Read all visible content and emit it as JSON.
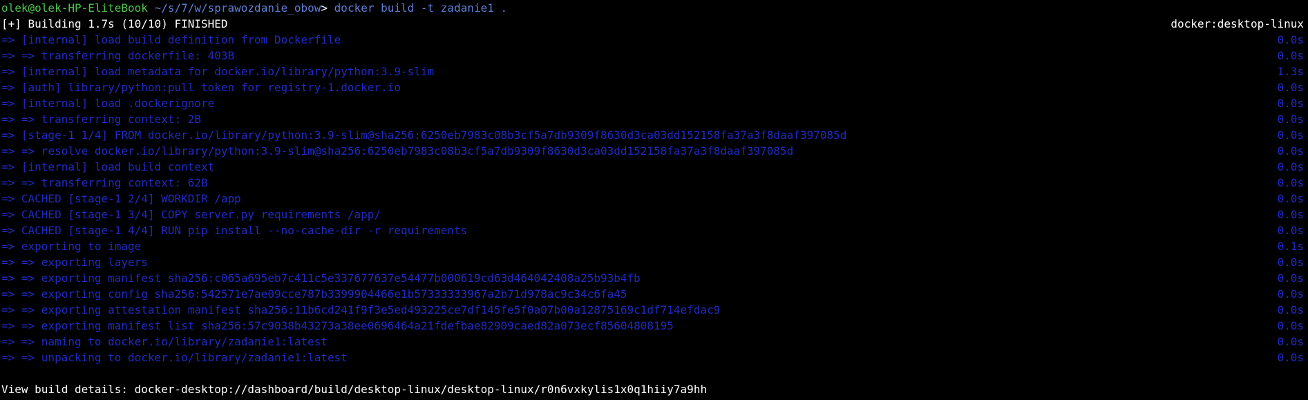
{
  "prompt": {
    "user_host": "olek@olek-HP-EliteBook",
    "path": "~/s/7/w/sprawozdanie_obow",
    "symbol": ">",
    "command": "docker build -t zadanie1 ."
  },
  "build_header": {
    "status": "[+] Building 1.7s (10/10) FINISHED",
    "context": "docker:desktop-linux"
  },
  "steps": [
    {
      "text": "=> [internal] load build definition from Dockerfile",
      "time": "0.0s"
    },
    {
      "text": "=> => transferring dockerfile: 403B",
      "time": "0.0s"
    },
    {
      "text": "=> [internal] load metadata for docker.io/library/python:3.9-slim",
      "time": "1.3s"
    },
    {
      "text": "=> [auth] library/python:pull token for registry-1.docker.io",
      "time": "0.0s"
    },
    {
      "text": "=> [internal] load .dockerignore",
      "time": "0.0s"
    },
    {
      "text": "=> => transferring context: 2B",
      "time": "0.0s"
    },
    {
      "text": "=> [stage-1 1/4] FROM docker.io/library/python:3.9-slim@sha256:6250eb7983c08b3cf5a7db9309f8630d3ca03dd152158fa37a3f8daaf397085d",
      "time": "0.0s"
    },
    {
      "text": "=> => resolve docker.io/library/python:3.9-slim@sha256:6250eb7983c08b3cf5a7db9309f8630d3ca03dd152158fa37a3f8daaf397085d",
      "time": "0.0s"
    },
    {
      "text": "=> [internal] load build context",
      "time": "0.0s"
    },
    {
      "text": "=> => transferring context: 62B",
      "time": "0.0s"
    },
    {
      "text": "=> CACHED [stage-1 2/4] WORKDIR /app",
      "time": "0.0s"
    },
    {
      "text": "=> CACHED [stage-1 3/4] COPY server.py requirements /app/",
      "time": "0.0s"
    },
    {
      "text": "=> CACHED [stage-1 4/4] RUN pip install --no-cache-dir -r requirements",
      "time": "0.0s"
    },
    {
      "text": "=> exporting to image",
      "time": "0.1s"
    },
    {
      "text": "=> => exporting layers",
      "time": "0.0s"
    },
    {
      "text": "=> => exporting manifest sha256:c065a695eb7c411c5e337677637e54477b000619cd63d464042408a25b93b4fb",
      "time": "0.0s"
    },
    {
      "text": "=> => exporting config sha256:542571e7ae09cce787b3399904466e1b57333333967a2b71d978ac9c34c6fa45",
      "time": "0.0s"
    },
    {
      "text": "=> => exporting attestation manifest sha256:11b6cd241f9f3e5ed493225ce7df145fe5f0a07b00a12875169c1df714efdac9",
      "time": "0.0s"
    },
    {
      "text": "=> => exporting manifest list sha256:57c9038b43273a38ee0696464a21fdefbae82909caed82a073ecf85604808195",
      "time": "0.0s"
    },
    {
      "text": "=> => naming to docker.io/library/zadanie1:latest",
      "time": "0.0s"
    },
    {
      "text": "=> => unpacking to docker.io/library/zadanie1:latest",
      "time": "0.0s"
    }
  ],
  "footer": {
    "build_details": "View build details: docker-desktop://dashboard/build/desktop-linux/desktop-linux/r0n6vxkylis1x0q1hiiy7a9hh"
  },
  "colors": {
    "background": "#000000",
    "prompt_user": "#4ec54e",
    "prompt_path_command": "#5f7fd6",
    "step_text": "#1f2bc5",
    "plain_text": "#ffffff"
  }
}
